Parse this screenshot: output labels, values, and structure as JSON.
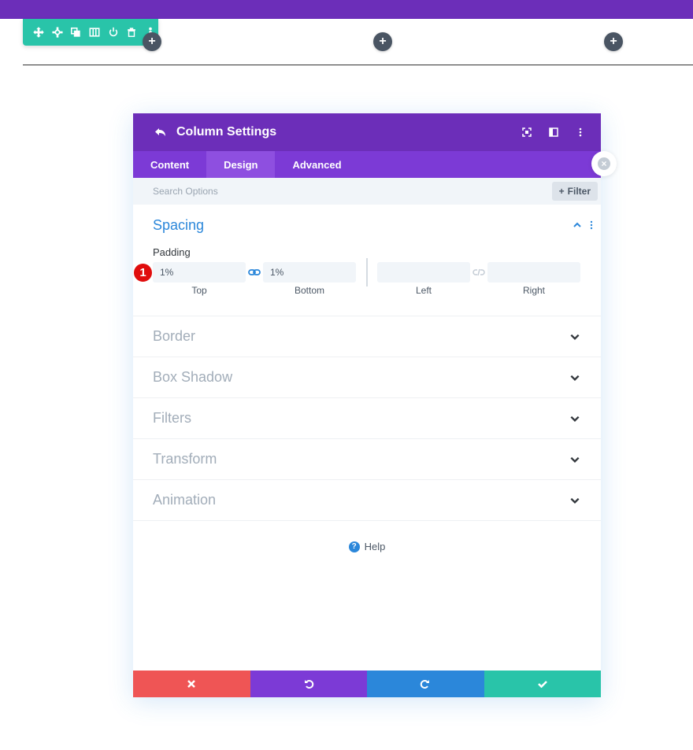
{
  "builder": {
    "accent_purple": "#6c2eb9",
    "row_toolbar": {
      "icons": [
        "move-icon",
        "gear-icon",
        "duplicate-icon",
        "columns-icon",
        "power-icon",
        "trash-icon",
        "more-icon"
      ]
    },
    "column_add_buttons": [
      "+",
      "+",
      "+"
    ]
  },
  "modal": {
    "title": "Column Settings",
    "tabs": [
      {
        "label": "Content",
        "active": false
      },
      {
        "label": "Design",
        "active": true
      },
      {
        "label": "Advanced",
        "active": false
      }
    ],
    "search": {
      "placeholder": "Search Options",
      "filter_label": "Filter"
    },
    "spacing": {
      "title": "Spacing",
      "padding_label": "Padding",
      "fields": [
        {
          "label": "Top",
          "value": "1%"
        },
        {
          "label": "Bottom",
          "value": "1%"
        },
        {
          "label": "Left",
          "value": ""
        },
        {
          "label": "Right",
          "value": ""
        }
      ]
    },
    "sections": [
      {
        "title": "Border"
      },
      {
        "title": "Box Shadow"
      },
      {
        "title": "Filters"
      },
      {
        "title": "Transform"
      },
      {
        "title": "Animation"
      }
    ],
    "help_label": "Help",
    "footer": {
      "colors": {
        "discard": "#ef5555",
        "undo": "#7c3ad6",
        "redo": "#2b87da",
        "save": "#29c4a9"
      }
    }
  },
  "annotation_badge": "1"
}
